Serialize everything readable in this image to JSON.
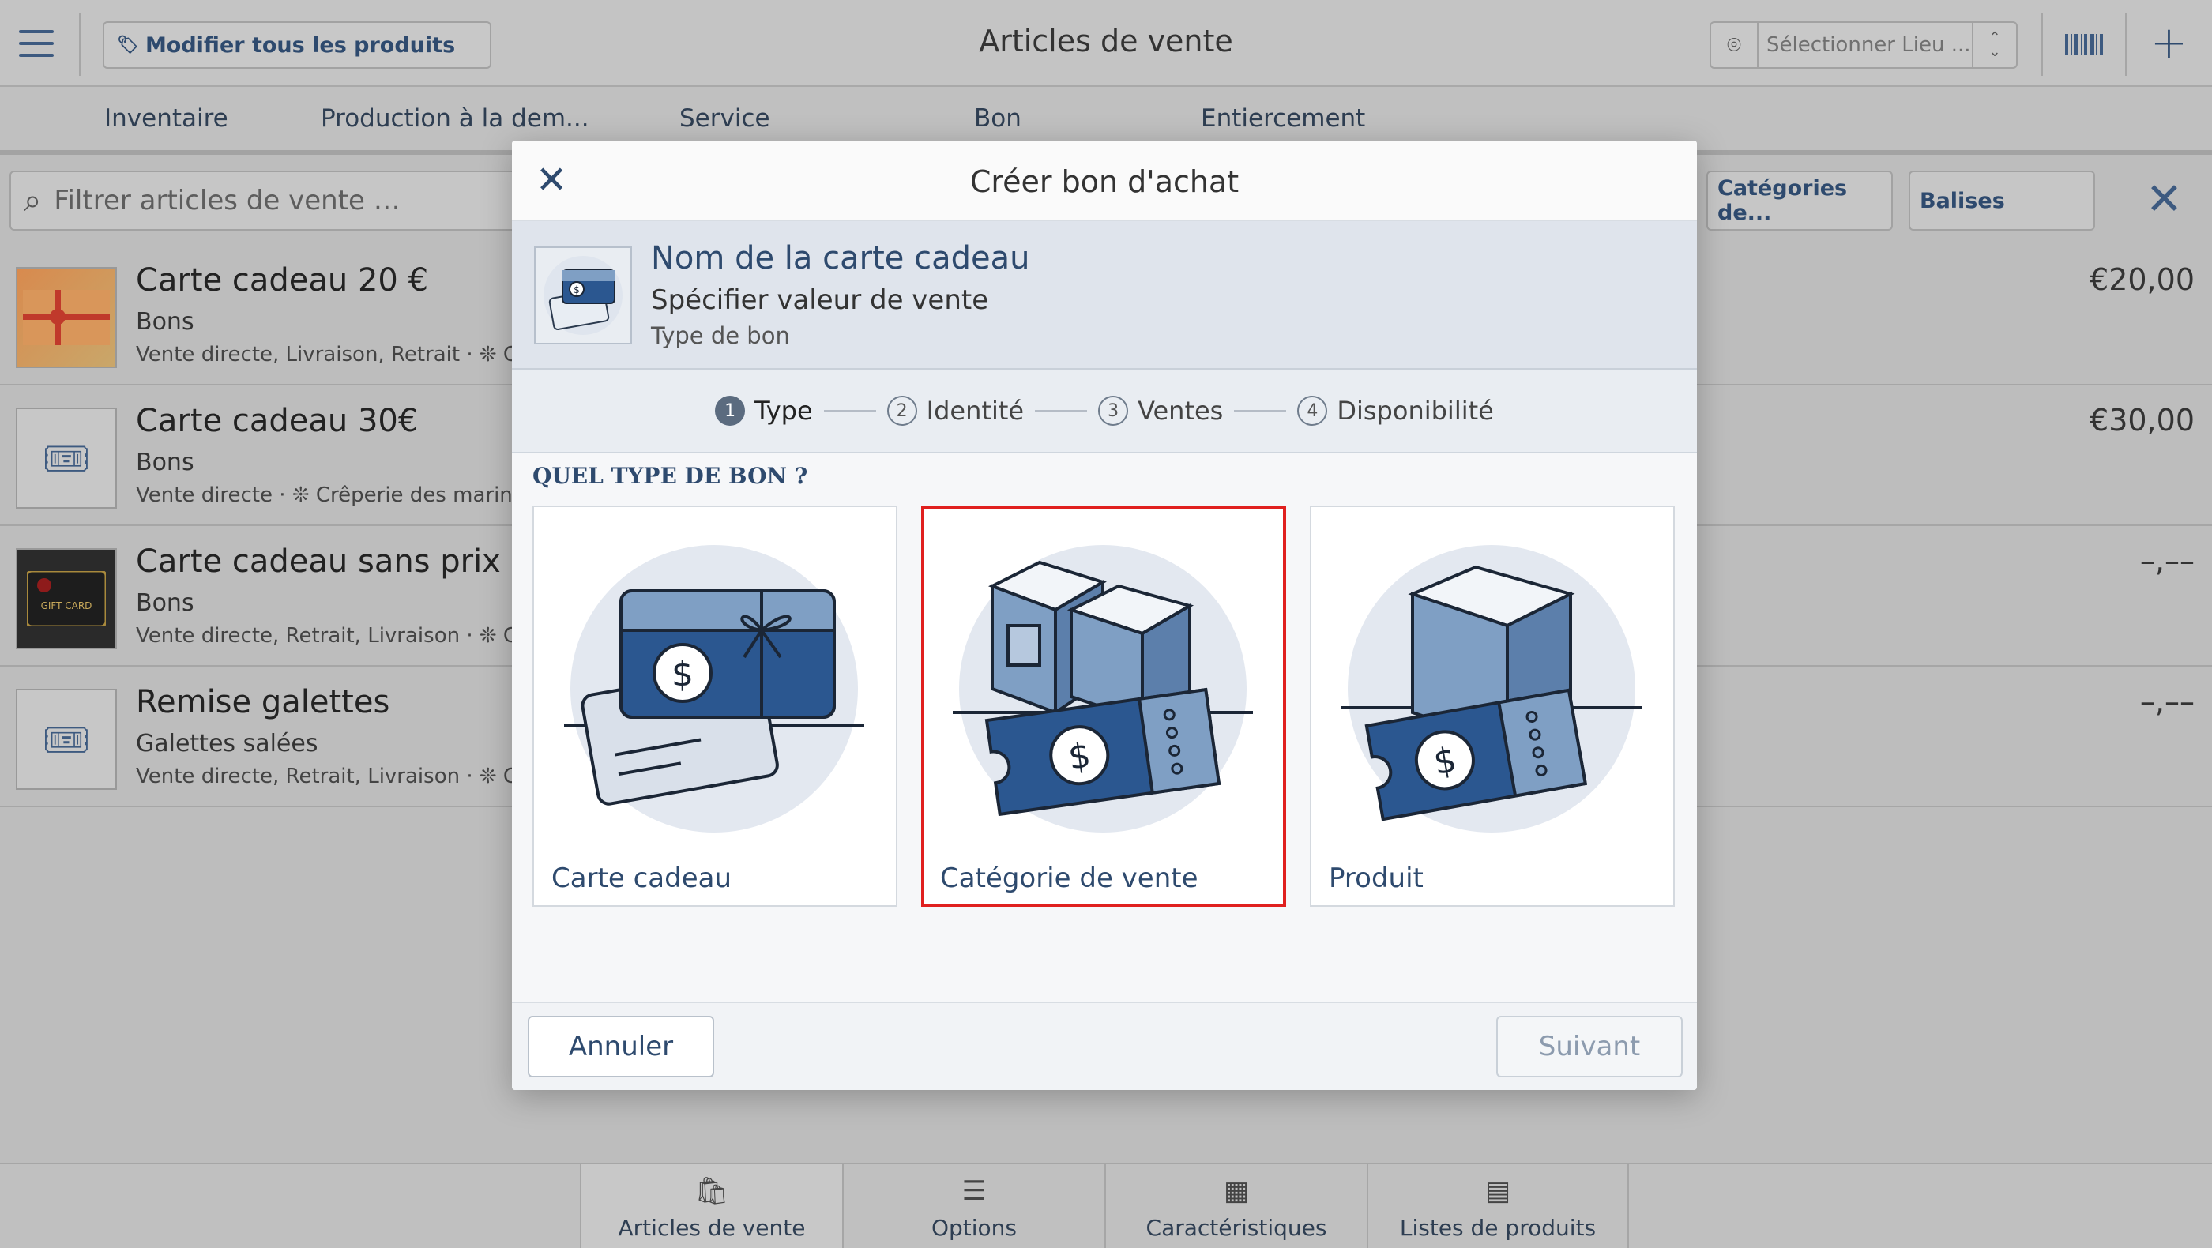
{
  "header": {
    "edit_all": "Modifier tous les produits",
    "title": "Articles de vente",
    "location_placeholder": "Sélectionner Lieu ......"
  },
  "tabs": [
    "Inventaire",
    "Production à la dem...",
    "Service",
    "Bon",
    "Entiercement"
  ],
  "filter": {
    "placeholder": "Filtrer articles de vente …",
    "categories_chip": "Catégories de...",
    "tags_chip": "Balises"
  },
  "items": [
    {
      "name": "Carte cadeau 20 €",
      "category": "Bons",
      "meta": "Vente directe, Livraison, Retrait · ❊ Cr",
      "price": "€20,00"
    },
    {
      "name": "Carte cadeau 30€",
      "category": "Bons",
      "meta": "Vente directe · ❊ Crêperie des marins",
      "price": "€30,00"
    },
    {
      "name": "Carte cadeau sans prix",
      "category": "Bons",
      "meta": "Vente directe, Retrait, Livraison · ❊ Cr",
      "price": "–,––"
    },
    {
      "name": "Remise galettes",
      "category": "Galettes salées",
      "meta": "Vente directe, Retrait, Livraison · ❊ Cr",
      "price": "–,––"
    }
  ],
  "bottom_nav": [
    "Articles de vente",
    "Options",
    "Caractéristiques",
    "Listes de produits"
  ],
  "modal": {
    "title": "Créer bon d'achat",
    "card_name": "Nom de la carte cadeau",
    "sale_value": "Spécifier valeur de vente",
    "voucher_type": "Type de bon",
    "steps": [
      {
        "num": "1",
        "label": "Type"
      },
      {
        "num": "2",
        "label": "Identité"
      },
      {
        "num": "3",
        "label": "Ventes"
      },
      {
        "num": "4",
        "label": "Disponibilité"
      }
    ],
    "question": "QUEL TYPE DE BON ?",
    "options": [
      "Carte cadeau",
      "Catégorie de vente",
      "Produit"
    ],
    "cancel": "Annuler",
    "next": "Suivant"
  },
  "colors": {
    "accent": "#2e4a6e",
    "selection": "#e0201f",
    "illus_dark": "#2b5790",
    "illus_light": "#7f9fc4"
  }
}
